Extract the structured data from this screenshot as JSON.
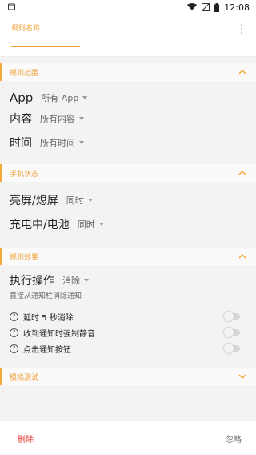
{
  "status_bar": {
    "time": "12:08"
  },
  "header": {
    "rule_name_label": "规则名称"
  },
  "sections": {
    "scope": {
      "title": "规则范围",
      "rows": {
        "app": {
          "label": "App",
          "value": "所有 App"
        },
        "content": {
          "label": "内容",
          "value": "所有内容"
        },
        "time": {
          "label": "时间",
          "value": "所有时间"
        }
      }
    },
    "phone_state": {
      "title": "手机状态",
      "rows": {
        "screen": {
          "label": "亮屏/熄屏",
          "value": "同时"
        },
        "charging": {
          "label": "充电中/电池",
          "value": "同时"
        }
      }
    },
    "effect": {
      "title": "规则效果",
      "action_label": "执行操作",
      "action_value": "消除",
      "action_desc": "直接从通知栏消除通知",
      "options": [
        {
          "label": "延时 5 秒消除",
          "enabled": false
        },
        {
          "label": "收到通知时强制静音",
          "enabled": false
        },
        {
          "label": "点击通知按钮",
          "enabled": false
        }
      ]
    },
    "test": {
      "title": "模拟测试"
    }
  },
  "footer": {
    "delete": "删除",
    "ignore": "忽略"
  },
  "colors": {
    "accent": "#f5a93a",
    "danger": "#e53935"
  }
}
